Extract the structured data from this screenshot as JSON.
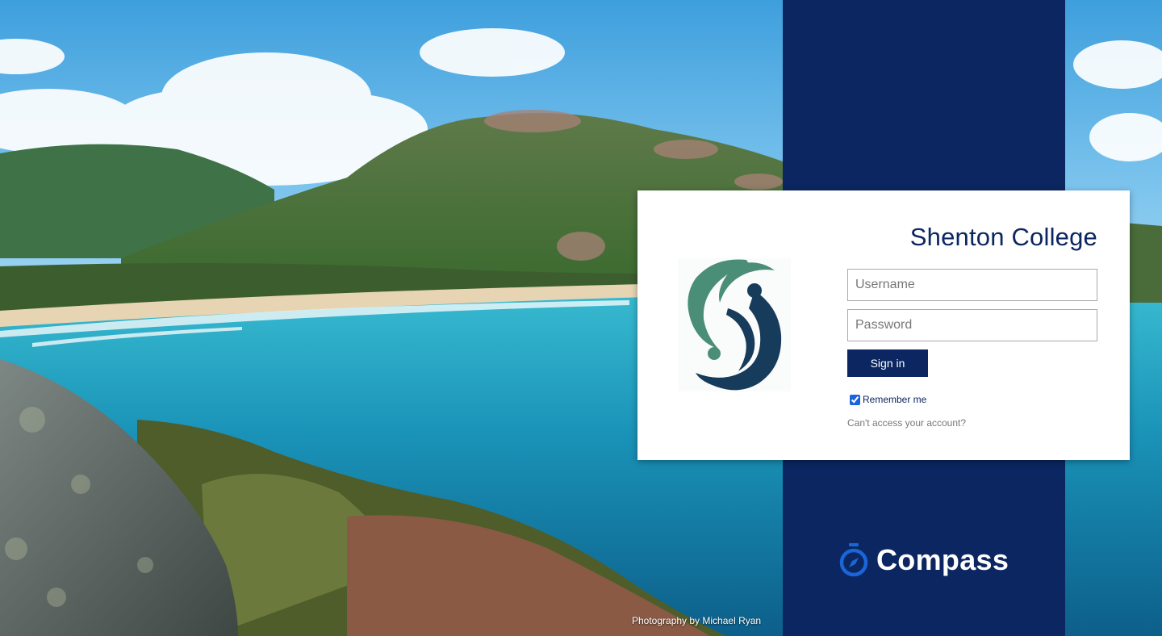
{
  "brand": {
    "school_name": "Shenton College",
    "app_name": "Compass",
    "band_color": "#0b2660",
    "accent_color": "#1a66d9",
    "logo_icon": "shenton-college-s-logo",
    "compass_icon": "compass-stopwatch-icon"
  },
  "login": {
    "username_placeholder": "Username",
    "username_value": "",
    "password_placeholder": "Password",
    "password_value": "",
    "signin_label": "Sign in",
    "remember_label": "Remember me",
    "remember_checked": true,
    "help_link": "Can't access your account?"
  },
  "background": {
    "photo_credit": "Photography by Michael Ryan"
  }
}
